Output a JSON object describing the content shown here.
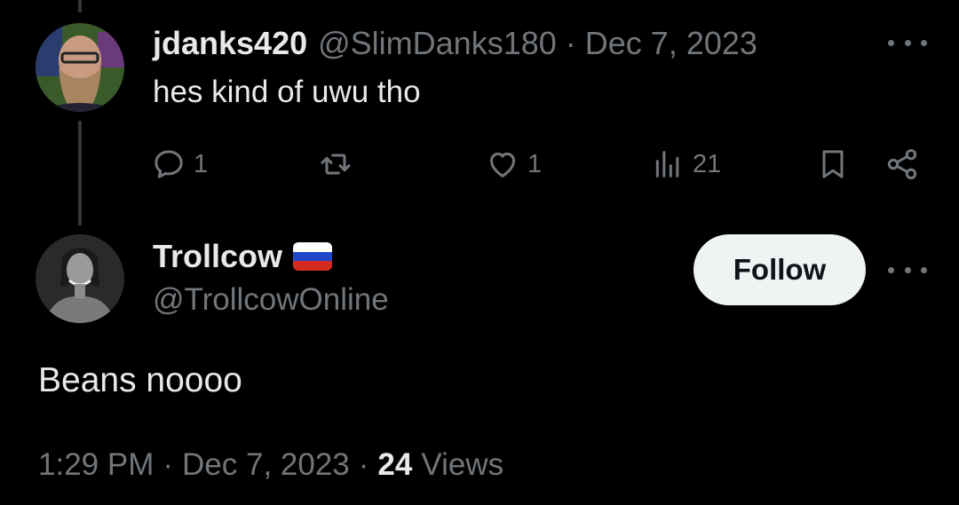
{
  "reply": {
    "display_name": "jdanks420",
    "handle": "@SlimDanks180",
    "separator": "·",
    "date": "Dec 7, 2023",
    "text": "hes kind of uwu tho",
    "avatar_icon": "avatar-bearded-man-icon",
    "actions": {
      "reply_count": "1",
      "repost_count": "",
      "like_count": "1",
      "views_count": "21"
    }
  },
  "tweet": {
    "display_name": "Trollcow",
    "handle": "@TrollcowOnline",
    "flag_icon": "russia-flag-icon",
    "flag_colors": [
      "#ffffff",
      "#1f47c9",
      "#d52b1e"
    ],
    "follow_label": "Follow",
    "text": "Beans noooo",
    "time": "1:29 PM",
    "separator": "·",
    "date": "Dec 7, 2023",
    "views_count": "24",
    "views_label": "Views"
  },
  "colors": {
    "background": "#000000",
    "primary_text": "#e7e9ea",
    "secondary_text": "#71767b",
    "follow_button_bg": "#eff3f4"
  }
}
